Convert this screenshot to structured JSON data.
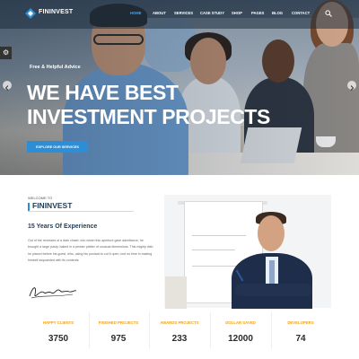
{
  "brand": {
    "name": "FININVEST"
  },
  "nav": {
    "items": [
      {
        "label": "HOME",
        "active": true
      },
      {
        "label": "ABOUT",
        "active": false
      },
      {
        "label": "SERVICES",
        "active": false
      },
      {
        "label": "CASE STUDY",
        "active": false
      },
      {
        "label": "SHOP",
        "active": false
      },
      {
        "label": "PAGES",
        "active": false
      },
      {
        "label": "BLOG",
        "active": false
      },
      {
        "label": "CONTACT",
        "active": false
      }
    ],
    "search_icon": "search-icon"
  },
  "hero": {
    "kicker": "Free & Helpful Advice",
    "title": "WE HAVE BEST INVESTMENT PROJECTS",
    "button_label": "EXPLORE OUR SERVICES",
    "settings_icon": "gear-icon"
  },
  "about": {
    "welcome": "WELCOME TO",
    "brand": "FININVEST",
    "experience": "15 Years Of Experience",
    "paragraph": "Out of the recesses of a dark closet, into which this aperture gave admittance, he brought a large pasty, baked in a pewter platter of unusual dimensions. This mighty dish he placed before his guest, who, using his poniard to cut it open, lost no time in making himself acquainted with its contents."
  },
  "stats": [
    {
      "label": "HAPPY CLIENTS",
      "value": "3750"
    },
    {
      "label": "FINISHED PROJECTS",
      "value": "975"
    },
    {
      "label": "AWARDS PROJECTS",
      "value": "233"
    },
    {
      "label": "DOLLAR SAVED",
      "value": "12000"
    },
    {
      "label": "DEVELOPERS",
      "value": "74"
    }
  ],
  "colors": {
    "accent": "#2c8ed6",
    "nav_active": "#3aa7ff",
    "stat_label": "#f0a21a",
    "heading": "#1f3d5a"
  }
}
